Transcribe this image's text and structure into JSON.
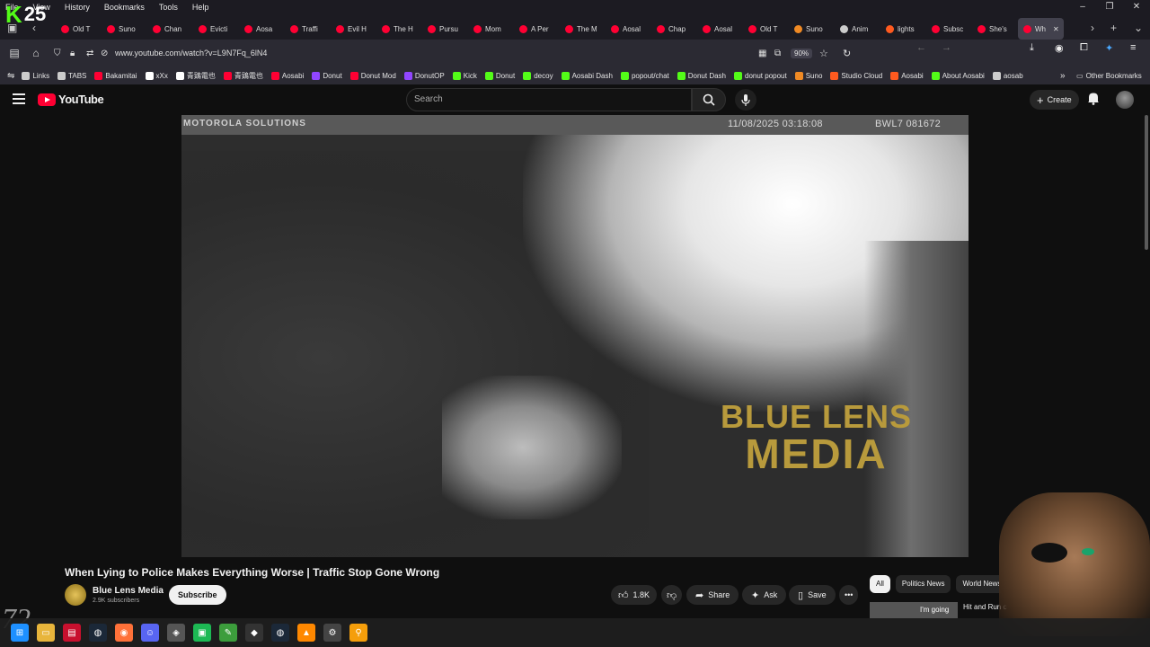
{
  "browser": {
    "menu": [
      "File",
      "View",
      "History",
      "Bookmarks",
      "Tools",
      "Help"
    ],
    "badge_number": "25",
    "tabs": [
      {
        "label": "Old T",
        "color": "#ff0033"
      },
      {
        "label": "Suno",
        "color": "#ff0033"
      },
      {
        "label": "Chan",
        "color": "#ff0033"
      },
      {
        "label": "Evicti",
        "color": "#ff0033"
      },
      {
        "label": "Aosa",
        "color": "#ff0033"
      },
      {
        "label": "Traffi",
        "color": "#ff0033"
      },
      {
        "label": "Evil H",
        "color": "#ff0033"
      },
      {
        "label": "The H",
        "color": "#ff0033"
      },
      {
        "label": "Pursu",
        "color": "#ff0033"
      },
      {
        "label": "Mom",
        "color": "#ff0033"
      },
      {
        "label": "A Per",
        "color": "#ff0033"
      },
      {
        "label": "The M",
        "color": "#ff0033"
      },
      {
        "label": "Aosal",
        "color": "#ff0033"
      },
      {
        "label": "Chap",
        "color": "#ff0033"
      },
      {
        "label": "Aosal",
        "color": "#ff0033"
      },
      {
        "label": "Old T",
        "color": "#ff0033"
      },
      {
        "label": "Suno",
        "color": "#f08a24"
      },
      {
        "label": "Anim",
        "color": "#cccccc"
      },
      {
        "label": "lights",
        "color": "#ff5a1f"
      },
      {
        "label": "Subsc",
        "color": "#ff0033"
      },
      {
        "label": "She's",
        "color": "#ff0033"
      },
      {
        "label": "Wh",
        "color": "#ff0033"
      }
    ],
    "url": "www.youtube.com/watch?v=L9N7Fq_6lN4",
    "zoom": "90%",
    "bookmarks": [
      {
        "label": "Links",
        "color": "#cccccc"
      },
      {
        "label": "TABS",
        "color": "#cccccc"
      },
      {
        "label": "Bakamitai",
        "color": "#ff0033"
      },
      {
        "label": "xXx",
        "color": "#ffffff"
      },
      {
        "label": "青鶏電也",
        "color": "#ffffff"
      },
      {
        "label": "青鶏電也",
        "color": "#ff0033"
      },
      {
        "label": "Aosabi",
        "color": "#ff0033"
      },
      {
        "label": "Donut",
        "color": "#9146ff"
      },
      {
        "label": "Donut Mod",
        "color": "#ff0033"
      },
      {
        "label": "DonutOP",
        "color": "#9146ff"
      },
      {
        "label": "Kick",
        "color": "#53fc18"
      },
      {
        "label": "Donut",
        "color": "#53fc18"
      },
      {
        "label": "decoy",
        "color": "#53fc18"
      },
      {
        "label": "Aosabi Dash",
        "color": "#53fc18"
      },
      {
        "label": "popout/chat",
        "color": "#53fc18"
      },
      {
        "label": "Donut Dash",
        "color": "#53fc18"
      },
      {
        "label": "donut popout",
        "color": "#53fc18"
      },
      {
        "label": "Suno",
        "color": "#f08a24"
      },
      {
        "label": "Studio Cloud",
        "color": "#ff5a1f"
      },
      {
        "label": "Aosabi",
        "color": "#ff5a1f"
      },
      {
        "label": "About Aosabi",
        "color": "#53fc18"
      },
      {
        "label": "aosab",
        "color": "#cccccc"
      }
    ],
    "other_bookmarks": "Other Bookmarks"
  },
  "youtube": {
    "logo_text": "YouTube",
    "search_placeholder": "Search",
    "create_label": "Create",
    "video": {
      "overlay_left": "MOTOROLA SOLUTIONS",
      "timestamp": "11/08/2025 03:18:08",
      "camera_id": "BWL7 081672",
      "watermark_line1": "BLUE LENS",
      "watermark_line2": "MEDIA"
    },
    "title": "When Lying to Police Makes Everything Worse | Traffic Stop Gone Wrong",
    "channel": {
      "name": "Blue Lens Media",
      "subs": "2.9K subscribers"
    },
    "subscribe_label": "Subscribe",
    "likes": "1.8K",
    "share_label": "Share",
    "ask_label": "Ask",
    "save_label": "Save",
    "chips": [
      "All",
      "Politics News",
      "World News"
    ],
    "rec_thumb_text": "I'm going",
    "rec_title": "Hit and Run c"
  },
  "overlay": {
    "logo_text": "72"
  },
  "colors": {
    "accent": "#ff0033",
    "kick": "#53fc18",
    "watermark": "#b89a3c"
  }
}
